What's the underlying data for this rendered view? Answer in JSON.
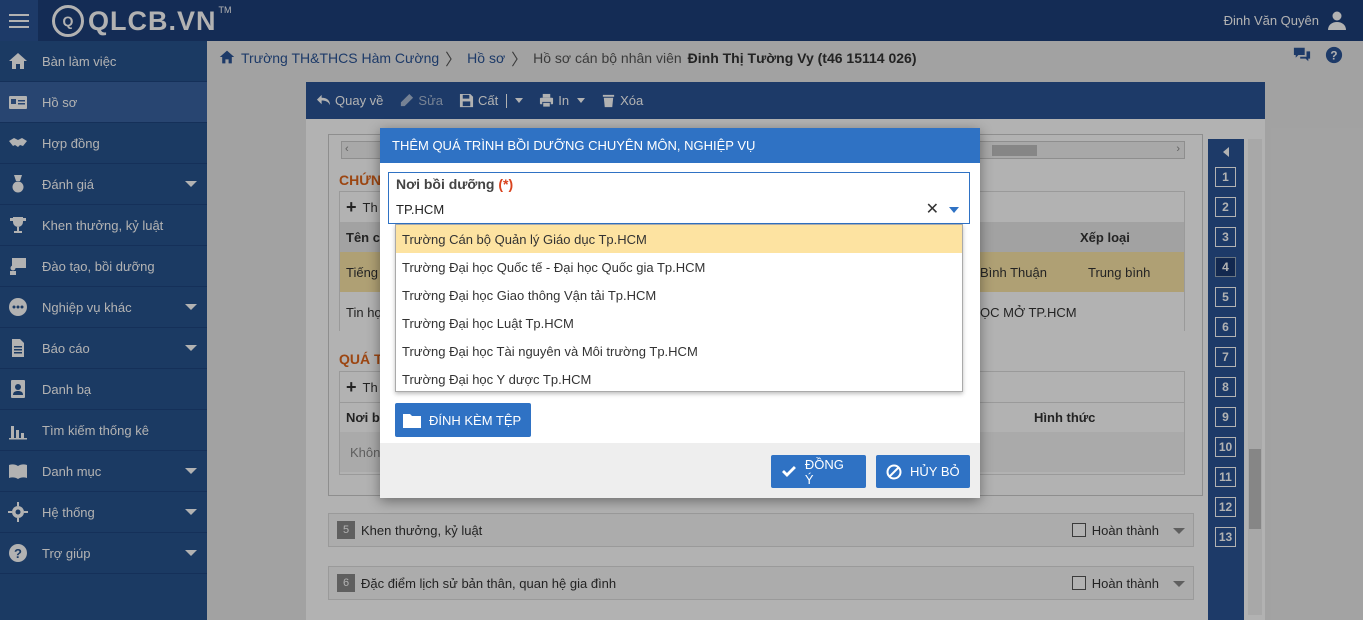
{
  "app": {
    "logo_text": "QLCB.VN",
    "logo_mark": "TM",
    "user_name": "Đinh Văn Quyên"
  },
  "sidebar": {
    "items": [
      {
        "label": "Bàn làm việc",
        "icon": "home-icon",
        "caret": false,
        "active": false
      },
      {
        "label": "Hồ sơ",
        "icon": "id-card-icon",
        "caret": false,
        "active": true
      },
      {
        "label": "Hợp đồng",
        "icon": "handshake-icon",
        "caret": false,
        "active": false
      },
      {
        "label": "Đánh giá",
        "icon": "medal-icon",
        "caret": true,
        "active": false
      },
      {
        "label": "Khen thưởng, kỷ luật",
        "icon": "trophy-icon",
        "caret": false,
        "active": false
      },
      {
        "label": "Đào tạo, bồi dưỡng",
        "icon": "teacher-icon",
        "caret": false,
        "active": false
      },
      {
        "label": "Nghiệp vụ khác",
        "icon": "ellipsis-icon",
        "caret": true,
        "active": false
      },
      {
        "label": "Báo cáo",
        "icon": "report-icon",
        "caret": true,
        "active": false
      },
      {
        "label": "Danh bạ",
        "icon": "contacts-icon",
        "caret": false,
        "active": false
      },
      {
        "label": "Tìm kiếm thống kê",
        "icon": "bar-chart-icon",
        "caret": false,
        "active": false
      },
      {
        "label": "Danh mục",
        "icon": "book-icon",
        "caret": true,
        "active": false
      },
      {
        "label": "Hệ thống",
        "icon": "gear-icon",
        "caret": true,
        "active": false
      },
      {
        "label": "Trợ giúp",
        "icon": "help-icon",
        "caret": true,
        "active": false
      }
    ]
  },
  "breadcrumb": {
    "school": "Trường TH&THCS Hàm Cường",
    "records": "Hồ sơ",
    "current_prefix": "Hồ sơ cán bộ nhân viên",
    "current_name": "Đinh Thị Tường Vy (t46 15114 026)"
  },
  "toolbar": {
    "back": "Quay về",
    "edit": "Sửa",
    "save": "Cất",
    "print": "In",
    "delete": "Xóa"
  },
  "background": {
    "section1_title": "CHỨN",
    "section1_add": "Th",
    "section1_col1": "Tên ch",
    "section1_col_rank": "Xếp loại",
    "row1_c1": "Tiếng",
    "row1_place": "Bình Thuận",
    "row1_rank": "Trung bình",
    "row2_c1": "Tin họ",
    "row2_place": "ỌC MỞ TP.HCM",
    "section2_title": "QUÁ T",
    "section2_add": "Th",
    "section2_col1": "Nơi bồ",
    "section2_col_form": "Hình thức",
    "section2_empty": "Khôn",
    "acc5_num": "5",
    "acc5_label": "Khen thưởng, kỷ luật",
    "acc6_num": "6",
    "acc6_label": "Đặc điểm lịch sử bản thân, quan hệ gia đình",
    "done_label": "Hoàn thành"
  },
  "steps": [
    "1",
    "2",
    "3",
    "4",
    "5",
    "6",
    "7",
    "8",
    "9",
    "10",
    "11",
    "12",
    "13"
  ],
  "current_step": "4",
  "modal": {
    "title": "THÊM QUÁ TRÌNH BỒI DƯỠNG CHUYÊN MÔN, NGHIỆP VỤ",
    "field_label": "Nơi bồi dưỡng",
    "required_mark": "(*)",
    "field_value": "TP.HCM",
    "options": [
      "Trường Cán bộ Quản lý Giáo dục Tp.HCM",
      "Trường Đại học Quốc tế - Đại học Quốc gia Tp.HCM",
      "Trường Đại học Giao thông Vận tải Tp.HCM",
      "Trường Đại học Luật Tp.HCM",
      "Trường Đại học Tài nguyên và Môi trường Tp.HCM",
      "Trường Đại học Y dược Tp.HCM"
    ],
    "attach_label": "ĐÍNH KÈM TỆP",
    "ok_label": "ĐỒNG Ý",
    "cancel_label": "HỦY BỎ"
  },
  "colors": {
    "topbar": "#1d3f7a",
    "sidebar": "#27538f",
    "primary": "#2f72c4",
    "highlight": "#fde3a1",
    "accent": "#e0651a"
  }
}
